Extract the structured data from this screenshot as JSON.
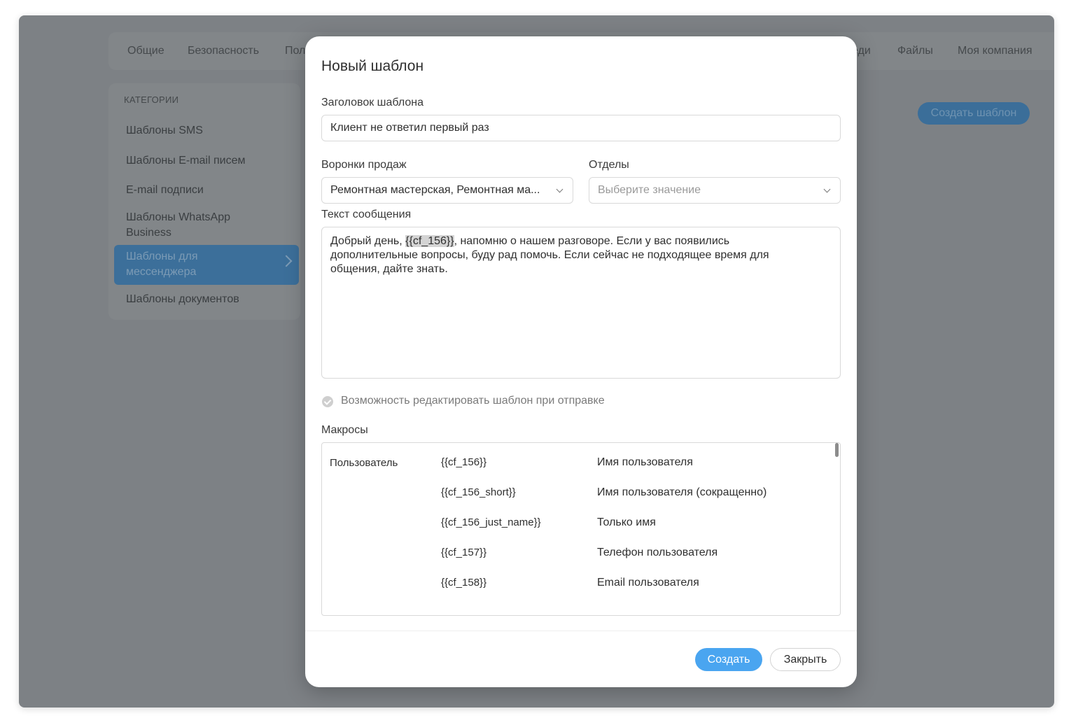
{
  "background": {
    "nav": [
      "Общие",
      "Безопасность",
      "Пол",
      "еди",
      "Файлы",
      "Моя компания"
    ],
    "sidebar": {
      "title": "КАТЕГОРИИ",
      "items": [
        "Шаблоны SMS",
        "Шаблоны E-mail писем",
        "E-mail подписи",
        "Шаблоны WhatsApp Business",
        "Шаблоны для мессенджера",
        "Шаблоны документов"
      ],
      "active_item": "Шаблоны для мессенджера"
    },
    "create_button": "Создать шаблон"
  },
  "modal": {
    "title": "Новый шаблон",
    "template_title_label": "Заголовок шаблона",
    "template_title_value": "Клиент не ответил первый раз",
    "funnels_label": "Воронки продаж",
    "funnels_value": "Ремонтная мастерская, Ремонтная ма...",
    "departments_label": "Отделы",
    "departments_placeholder": "Выберите значение",
    "message_label": "Текст сообщения",
    "message_before": "Добрый день, ",
    "message_macro": "{{cf_156}}",
    "message_after": ", напомню о нашем разговоре. Если у вас появились дополнительные вопросы, буду рад помочь. Если сейчас не подходящее время для общения, дайте знать.",
    "editable_label": "Возможность редактировать шаблон при отправке",
    "macros_label": "Макросы",
    "macros_group": "Пользователь",
    "macros": [
      {
        "code": "{{cf_156}}",
        "desc": "Имя пользователя"
      },
      {
        "code": "{{cf_156_short}}",
        "desc": "Имя пользователя (сокращенно)"
      },
      {
        "code": "{{cf_156_just_name}}",
        "desc": "Только имя"
      },
      {
        "code": "{{cf_157}}",
        "desc": "Телефон пользователя"
      },
      {
        "code": "{{cf_158}}",
        "desc": "Email пользователя"
      }
    ],
    "create_button": "Создать",
    "close_button": "Закрыть"
  },
  "colors": {
    "overlay": "#7d8185",
    "primary": "#4aa5f0",
    "active_item_dim": "#3c6f9a"
  },
  "icons": [
    "chevron-right-icon",
    "chevron-down-icon",
    "check-circle-icon"
  ]
}
